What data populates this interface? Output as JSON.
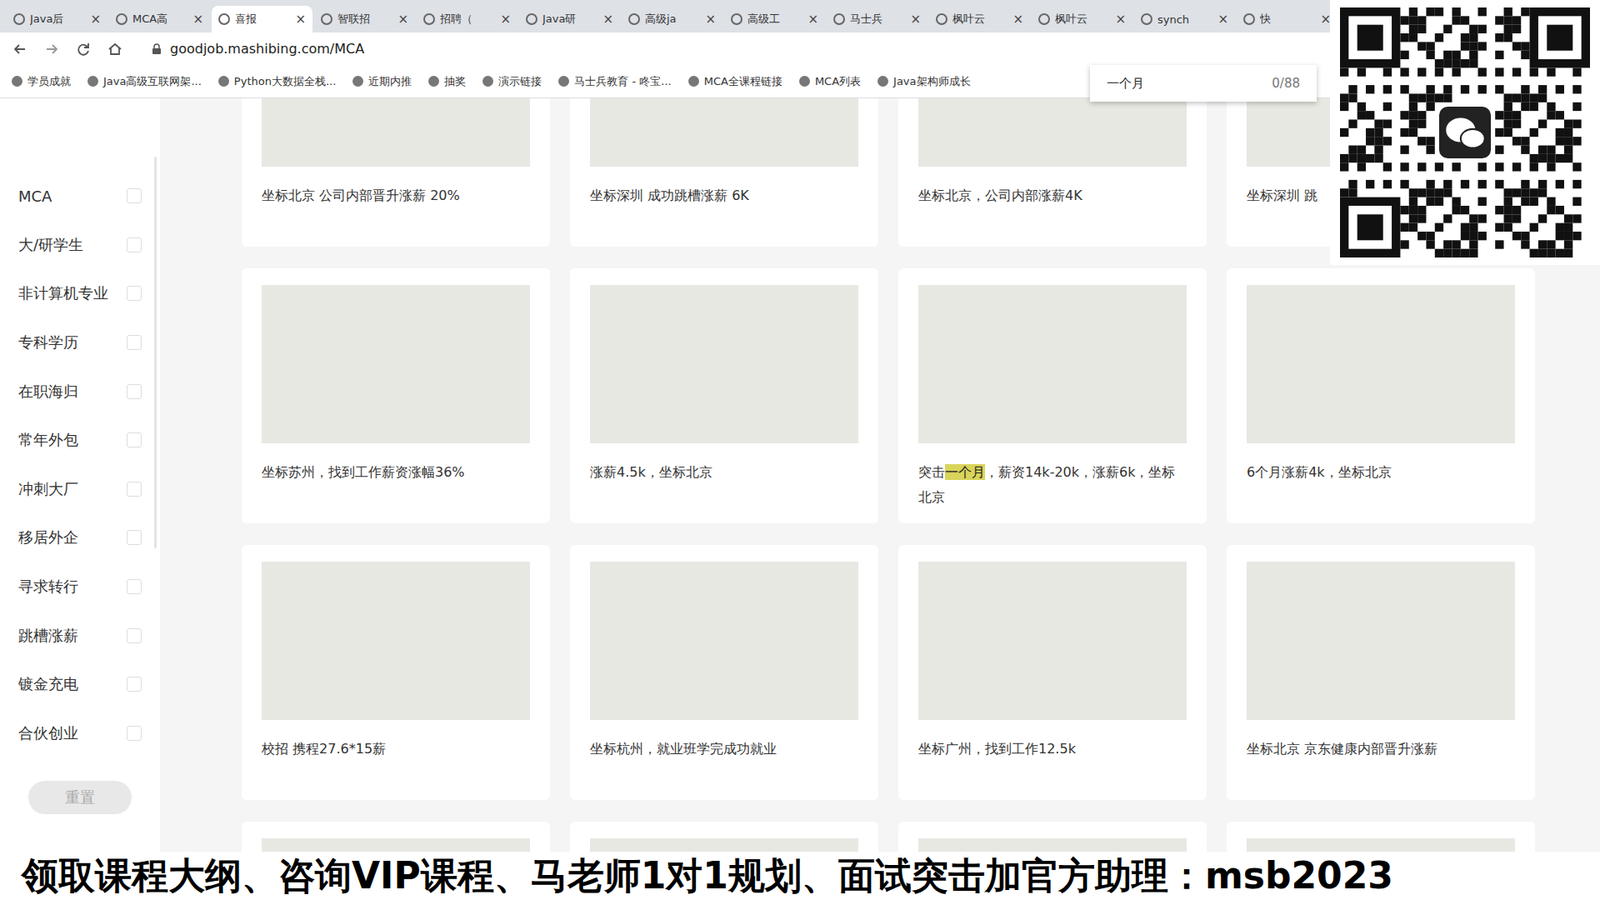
{
  "browser": {
    "tabs": [
      {
        "label": "Java后",
        "selected": false
      },
      {
        "label": "MCA高",
        "selected": false
      },
      {
        "label": "喜报",
        "selected": true
      },
      {
        "label": "智联招",
        "selected": false
      },
      {
        "label": "招聘（",
        "selected": false
      },
      {
        "label": "Java研",
        "selected": false
      },
      {
        "label": "高级ja",
        "selected": false
      },
      {
        "label": "高级工",
        "selected": false
      },
      {
        "label": "马士兵",
        "selected": false
      },
      {
        "label": "枫叶云",
        "selected": false
      },
      {
        "label": "枫叶云",
        "selected": false
      },
      {
        "label": "synch",
        "selected": false
      },
      {
        "label": "快",
        "selected": false
      }
    ],
    "tab_close": "×",
    "url": "goodjob.mashibing.com/MCA",
    "bookmarks": [
      "学员成就",
      "Java高级互联网架...",
      "Python大数据全栈...",
      "近期内推",
      "抽奖",
      "演示链接",
      "马士兵教育 - 咚宝...",
      "MCA全课程链接",
      "MCA列表",
      "Java架构师成长"
    ]
  },
  "find": {
    "query": "一个月",
    "count": "0/88"
  },
  "sidebar": {
    "items": [
      {
        "label": "MCA",
        "checked": false
      },
      {
        "label": "大/研学生",
        "checked": false
      },
      {
        "label": "非计算机专业",
        "checked": false
      },
      {
        "label": "专科学历",
        "checked": false
      },
      {
        "label": "在职海归",
        "checked": false
      },
      {
        "label": "常年外包",
        "checked": false
      },
      {
        "label": "冲刺大厂",
        "checked": false
      },
      {
        "label": "移居外企",
        "checked": false
      },
      {
        "label": "寻求转行",
        "checked": false
      },
      {
        "label": "跳槽涨薪",
        "checked": false
      },
      {
        "label": "镀金充电",
        "checked": false
      },
      {
        "label": "合伙创业",
        "checked": false
      }
    ],
    "reset": "重置"
  },
  "cards": [
    {
      "title": "坐标北京 公司内部晋升涨薪 20%"
    },
    {
      "title": "坐标深圳 成功跳槽涨薪 6K"
    },
    {
      "title": "坐标北京，公司内部涨薪4K"
    },
    {
      "title": "坐标深圳 跳"
    },
    {
      "title": "坐标苏州，找到工作薪资涨幅36%"
    },
    {
      "title": "涨薪4.5k，坐标北京"
    },
    {
      "title": "突击一个月，薪资14k-20k，涨薪6k，坐标北京"
    },
    {
      "title": "6个月涨薪4k，坐标北京"
    },
    {
      "title": "校招 携程27.6*15薪"
    },
    {
      "title": "坐标杭州，就业班学完成功就业"
    },
    {
      "title": "坐标广州，找到工作12.5k"
    },
    {
      "title": "坐标北京 京东健康内部晋升涨薪"
    },
    {
      "title": ""
    },
    {
      "title": ""
    },
    {
      "title": ""
    },
    {
      "title": ""
    }
  ],
  "banner": "领取课程大纲、咨询VIP课程、马老师1对1规划、面试突击加官方助理：msb2023"
}
